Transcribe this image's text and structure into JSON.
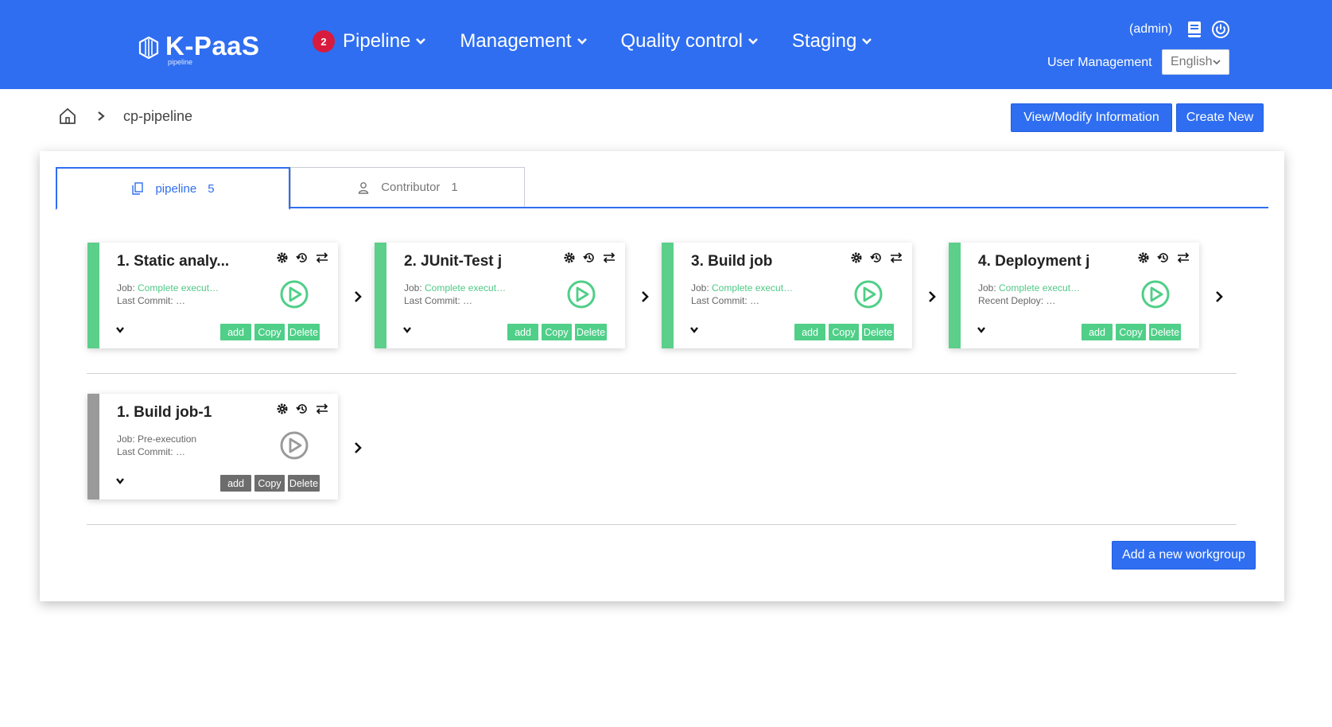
{
  "header": {
    "logo_text": "K-PaaS",
    "logo_sub": "pipeline",
    "nav": [
      {
        "label": "Pipeline",
        "badge": "2"
      },
      {
        "label": "Management"
      },
      {
        "label": "Quality control"
      },
      {
        "label": "Staging"
      }
    ],
    "admin_label": "(admin)",
    "user_management": "User Management",
    "language": "English"
  },
  "breadcrumb": {
    "current": "cp-pipeline"
  },
  "actions": {
    "view_modify": "View/Modify Information",
    "create_new": "Create New"
  },
  "tabs": [
    {
      "label": "pipeline",
      "count": "5"
    },
    {
      "label": "Contributor",
      "count": "1"
    }
  ],
  "workgroups": [
    {
      "jobs": [
        {
          "title": "1. Static analy...",
          "line1_label": "Job: ",
          "line1_value": "Complete execut…",
          "line2_label": "Last Commit: …",
          "status": "success"
        },
        {
          "title": "2. JUnit-Test j",
          "line1_label": "Job: ",
          "line1_value": "Complete execut…",
          "line2_label": "Last Commit: …",
          "status": "success"
        },
        {
          "title": "3. Build job",
          "line1_label": "Job: ",
          "line1_value": "Complete execut…",
          "line2_label": "Last Commit: …",
          "status": "success"
        },
        {
          "title": "4. Deployment j",
          "line1_label": "Job: ",
          "line1_value": "Complete execut…",
          "line2_label": "Recent Deploy: …",
          "status": "success"
        }
      ]
    },
    {
      "jobs": [
        {
          "title": "1. Build job-1",
          "line1_label": "Job: ",
          "line1_value": "Pre-execution",
          "line2_label": "Last Commit: …",
          "status": "pending"
        }
      ]
    }
  ],
  "card_buttons": {
    "add": "add",
    "copy": "Copy",
    "delete": "Delete"
  },
  "add_workgroup": "Add a new workgroup",
  "colors": {
    "primary": "#2f6ef0",
    "success": "#4fcf88",
    "pending": "#9a9a9a",
    "badge": "#d81b3c"
  }
}
